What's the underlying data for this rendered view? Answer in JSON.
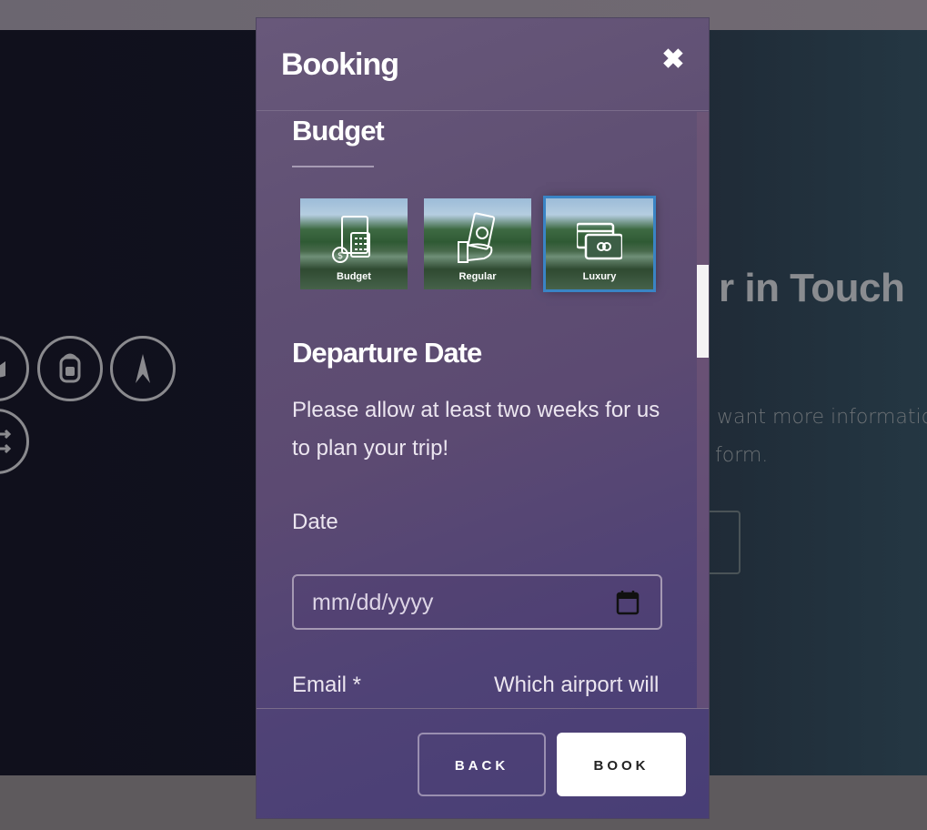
{
  "modal": {
    "title": "Booking",
    "close_symbol": "✖",
    "budget": {
      "heading": "Budget",
      "options": [
        {
          "label": "Budget",
          "icon": "calculator-money-icon",
          "selected": false
        },
        {
          "label": "Regular",
          "icon": "hand-cash-icon",
          "selected": false
        },
        {
          "label": "Luxury",
          "icon": "credit-card-icon",
          "selected": true
        }
      ]
    },
    "departure": {
      "heading": "Departure Date",
      "note_line1": "Please allow at least two weeks for us",
      "note_line2": "to plan your trip!",
      "date_label": "Date",
      "date_placeholder": "mm/dd/yyyy"
    },
    "email_label": "Email *",
    "airport_label": "Which airport will",
    "footer": {
      "back_label": "BACK",
      "book_label": "BOOK"
    }
  },
  "background": {
    "heading_fragment": "r in Touch",
    "text_line1": "want more informations",
    "text_line2": "form.",
    "icons": [
      "boat-icon",
      "backpack-icon",
      "compass-arrow-icon",
      "shuffle-icon"
    ]
  },
  "colors": {
    "selected_outline": "#3a84c5",
    "book_button_bg": "#ffffff"
  }
}
